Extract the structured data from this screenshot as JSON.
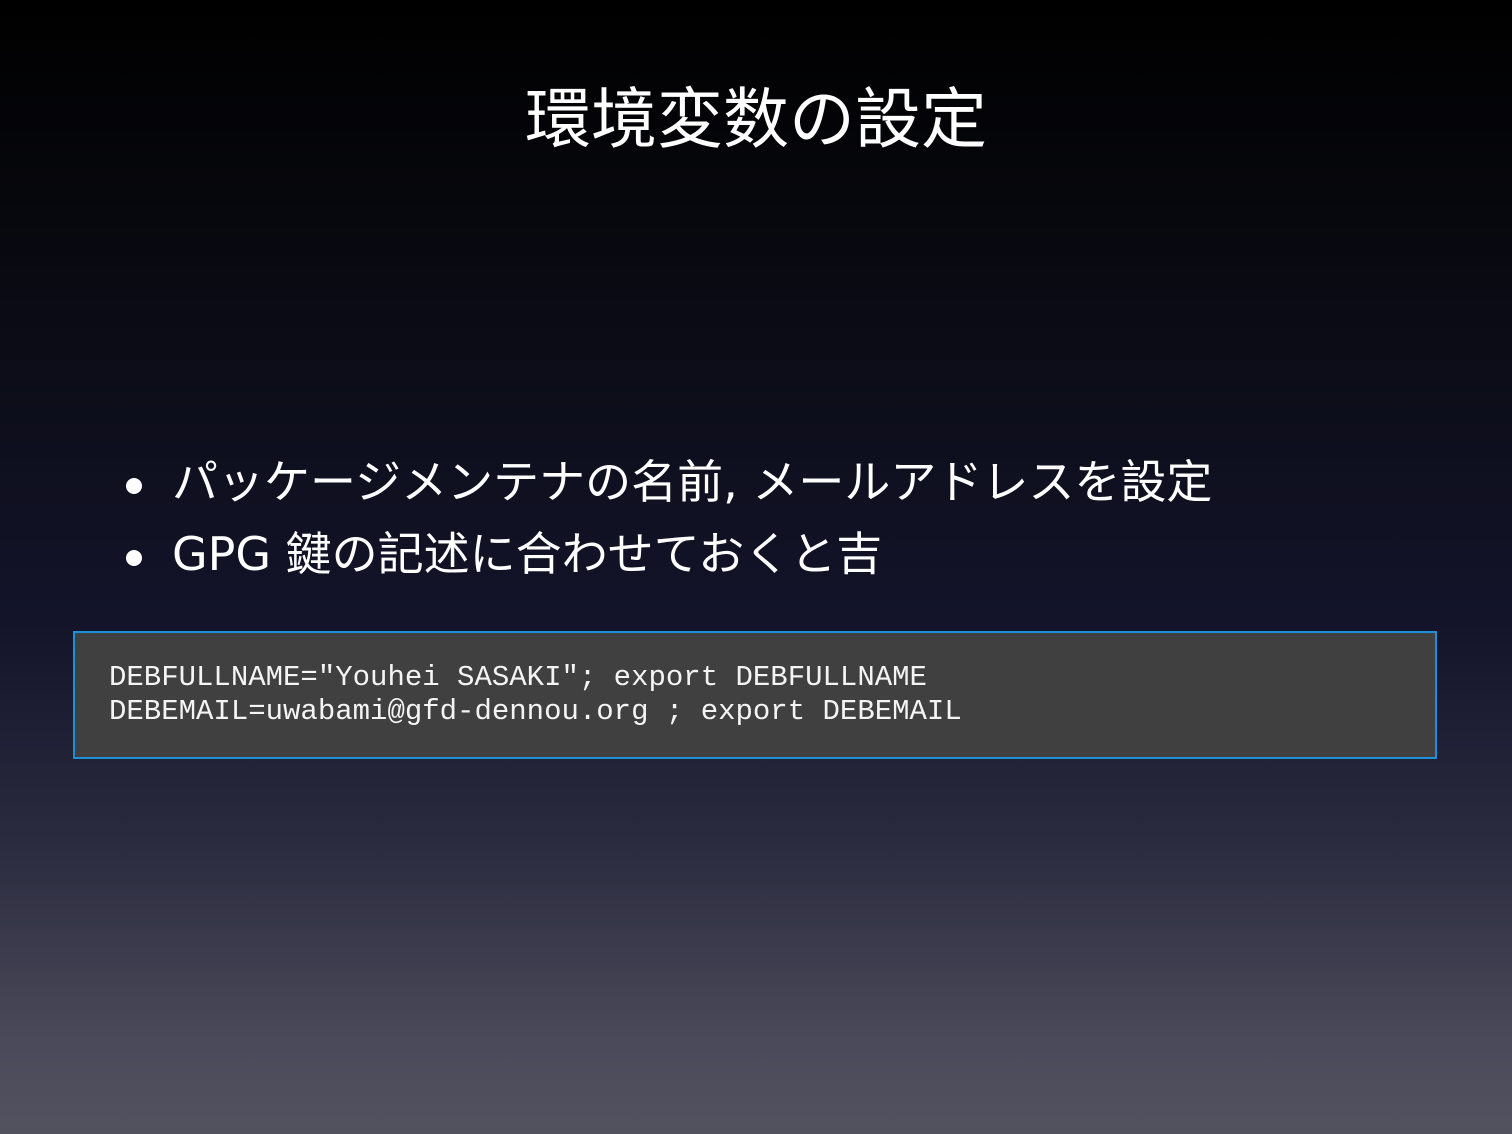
{
  "slide": {
    "title": "環境変数の設定",
    "bullets": [
      "パッケージメンテナの名前, メールアドレスを設定",
      "GPG 鍵の記述に合わせておくと吉"
    ],
    "code": {
      "lines": [
        "DEBFULLNAME=\"Youhei SASAKI\"; export DEBFULLNAME",
        "DEBEMAIL=uwabami@gfd-dennou.org ; export DEBEMAIL"
      ],
      "border_color": "#1e90d8",
      "background_color": "#404040"
    }
  }
}
